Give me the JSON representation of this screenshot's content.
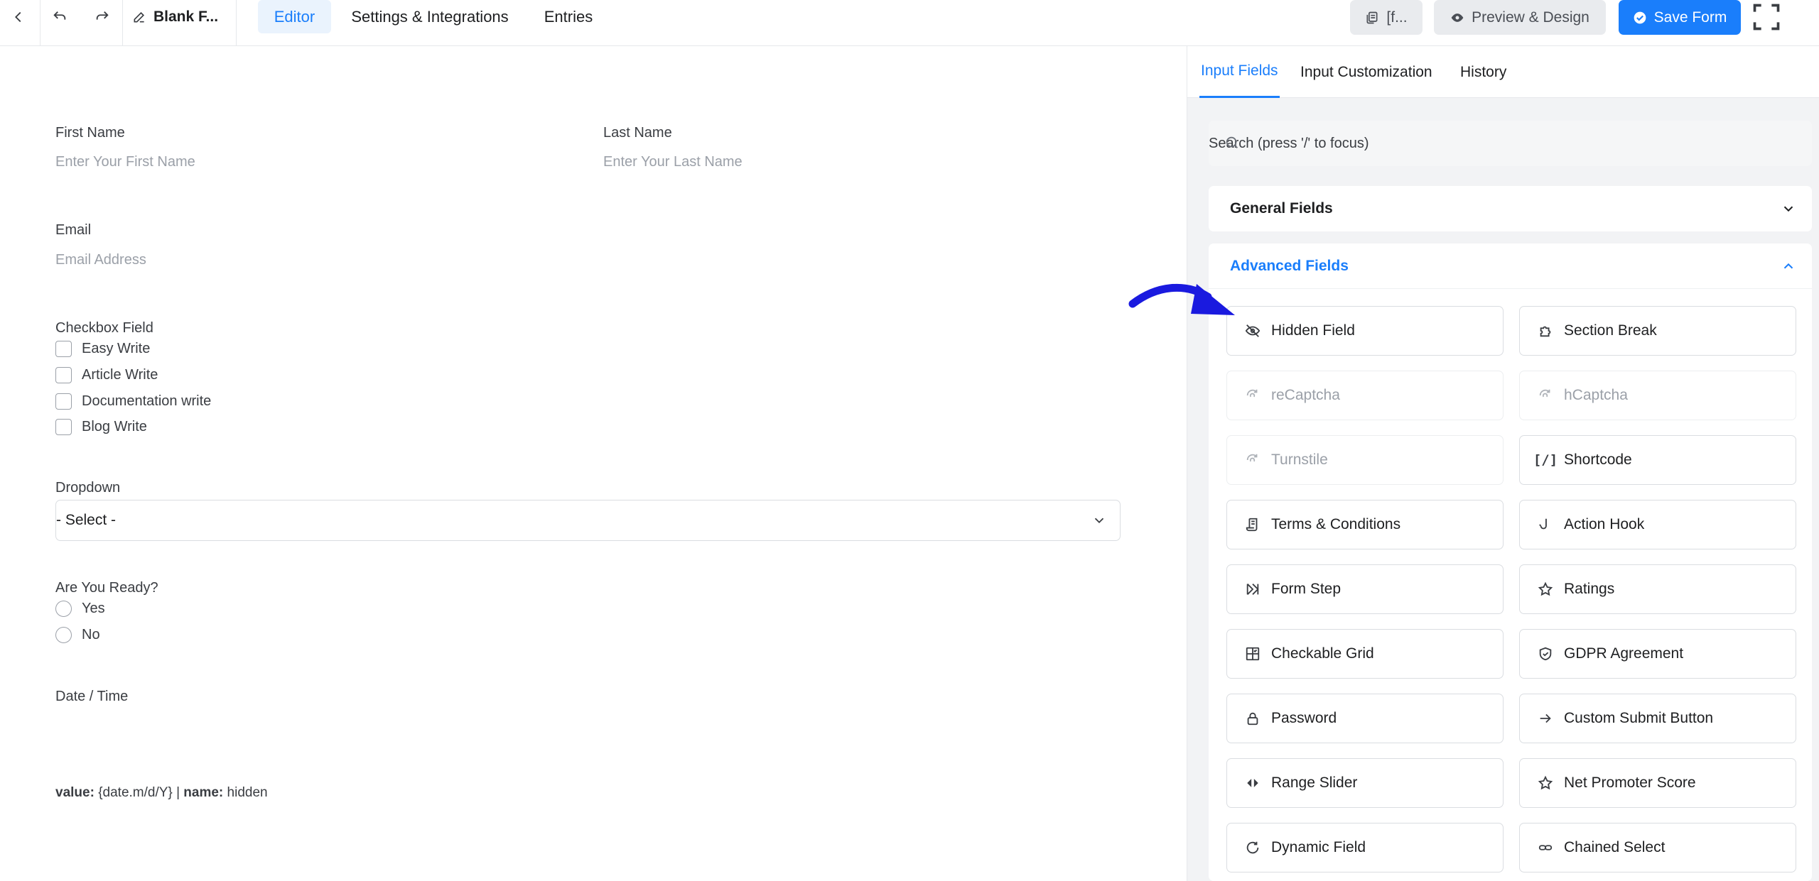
{
  "topbar": {
    "form_title": "Blank F...",
    "nav_tabs": [
      "Editor",
      "Settings & Integrations",
      "Entries"
    ],
    "shortcode_label": "[f...",
    "preview_label": "Preview & Design",
    "save_label": "Save Form"
  },
  "form": {
    "first_name": {
      "label": "First Name",
      "placeholder": "Enter Your First Name"
    },
    "last_name": {
      "label": "Last Name",
      "placeholder": "Enter Your Last Name"
    },
    "email": {
      "label": "Email",
      "placeholder": "Email Address"
    },
    "checkbox": {
      "label": "Checkbox Field",
      "options": [
        "Easy Write",
        "Article Write",
        "Documentation write",
        "Blog Write"
      ]
    },
    "dropdown": {
      "label": "Dropdown",
      "value": "- Select -"
    },
    "radio": {
      "label": "Are You Ready?",
      "options": [
        "Yes",
        "No"
      ]
    },
    "datetime": {
      "label": "Date / Time"
    },
    "hidden_meta": {
      "value_label": "value:",
      "value": "{date.m/d/Y}",
      "separator": "|",
      "name_label": "name:",
      "name": "hidden"
    }
  },
  "panel": {
    "tabs": [
      "Input Fields",
      "Input Customization",
      "History"
    ],
    "search_placeholder": "Search (press '/' to focus)",
    "general_fields": "General Fields",
    "advanced_fields": "Advanced Fields",
    "fields": [
      {
        "label": "Hidden Field",
        "icon": "eye-slash-icon",
        "enabled": true
      },
      {
        "label": "Section Break",
        "icon": "puzzle-icon",
        "enabled": true
      },
      {
        "label": "reCaptcha",
        "icon": "captcha-icon",
        "enabled": false
      },
      {
        "label": "hCaptcha",
        "icon": "captcha-icon",
        "enabled": false
      },
      {
        "label": "Turnstile",
        "icon": "captcha-icon",
        "enabled": false
      },
      {
        "label": "Shortcode",
        "icon": "shortcode-icon",
        "enabled": true
      },
      {
        "label": "Terms & Conditions",
        "icon": "scroll-icon",
        "enabled": true
      },
      {
        "label": "Action Hook",
        "icon": "hook-icon",
        "enabled": true
      },
      {
        "label": "Form Step",
        "icon": "step-icon",
        "enabled": true
      },
      {
        "label": "Ratings",
        "icon": "star-icon",
        "enabled": true
      },
      {
        "label": "Checkable Grid",
        "icon": "grid-icon",
        "enabled": true
      },
      {
        "label": "GDPR Agreement",
        "icon": "shield-icon",
        "enabled": true
      },
      {
        "label": "Password",
        "icon": "lock-icon",
        "enabled": true
      },
      {
        "label": "Custom Submit Button",
        "icon": "arrow-right-icon",
        "enabled": true
      },
      {
        "label": "Range Slider",
        "icon": "range-icon",
        "enabled": true
      },
      {
        "label": "Net Promoter Score",
        "icon": "star-icon",
        "enabled": true
      },
      {
        "label": "Dynamic Field",
        "icon": "refresh-icon",
        "enabled": true
      },
      {
        "label": "Chained Select",
        "icon": "link-icon",
        "enabled": true
      }
    ]
  },
  "colors": {
    "accent": "#1a7efb",
    "annotation_arrow": "#1a1adf"
  }
}
